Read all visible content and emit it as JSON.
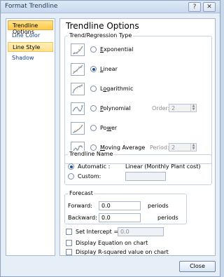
{
  "window": {
    "title": "Format Trendline",
    "help_glyph": "?",
    "close_glyph": "✕"
  },
  "sidebar": {
    "items": [
      {
        "label": "Trendline Options"
      },
      {
        "label": "Line Color"
      },
      {
        "label": "Line Style"
      },
      {
        "label": "Shadow"
      }
    ]
  },
  "panel": {
    "title": "Trendline Options",
    "regression": {
      "label": "Trend/Regression Type",
      "options": [
        {
          "label": "Exponential",
          "ul": "E",
          "rest": "xponential"
        },
        {
          "label": "Linear",
          "ul": "L",
          "rest": "inear"
        },
        {
          "label": "Logarithmic",
          "ul": "o",
          "pre": "L",
          "rest": "garithmic"
        },
        {
          "label": "Polynomial",
          "ul": "P",
          "rest": "olynomial"
        },
        {
          "label": "Power",
          "pre": "Po",
          "ul": "w",
          "rest": "er"
        },
        {
          "label": "Moving Average",
          "ul": "M",
          "rest": "oving Average"
        }
      ],
      "order_label": "Order:",
      "order_value": "2",
      "period_label": "Period:",
      "period_value": "2"
    },
    "name": {
      "label": "Trendline Name",
      "automatic_label": "Automatic :",
      "automatic_value": "Linear (Monthly Plant cost)",
      "custom_label": "Custom:",
      "custom_value": ""
    },
    "forecast": {
      "label": "Forecast",
      "forward_label": "Forward:",
      "forward_value": "0.0",
      "backward_label": "Backward:",
      "backward_value": "0.0",
      "unit": "periods"
    },
    "set_intercept_label": "Set Intercept =",
    "set_intercept_value": "0.0",
    "display_equation_label": "Display Equation on chart",
    "display_r2_label": "Display R-squared value on chart"
  },
  "buttons": {
    "close_label": "Close"
  }
}
